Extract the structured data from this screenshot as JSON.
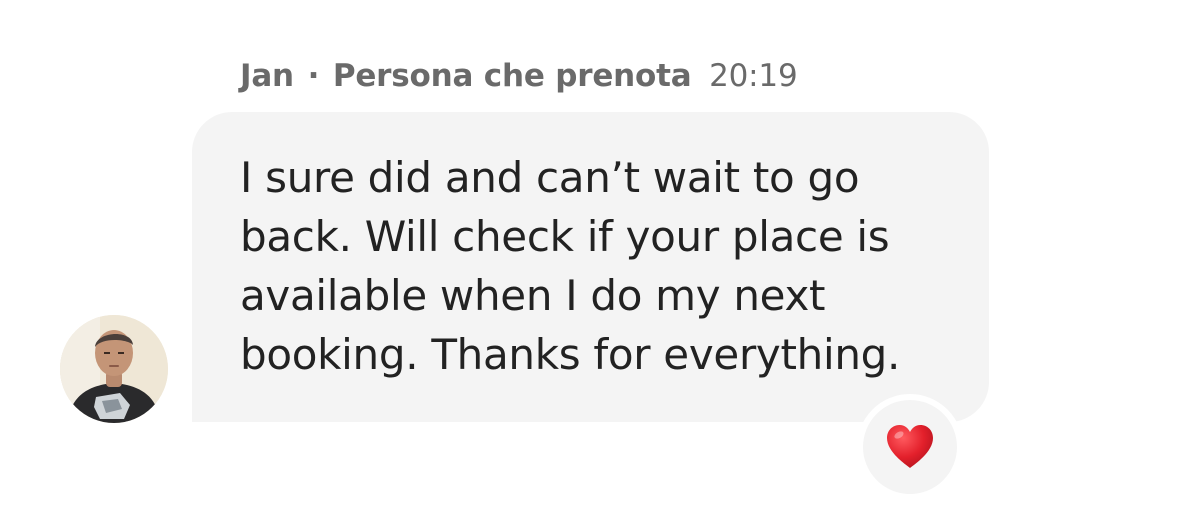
{
  "message": {
    "sender": "Jan",
    "separator": "·",
    "role": "Persona che prenota",
    "time": "20:19",
    "text": "I sure did and can’t wait to go\nback. Will check if your place is\navailable when I do my next\nbooking. Thanks for everything."
  },
  "reaction": {
    "icon": "heart-icon",
    "color": "#e0242e"
  },
  "avatar": {
    "icon": "user-avatar"
  }
}
